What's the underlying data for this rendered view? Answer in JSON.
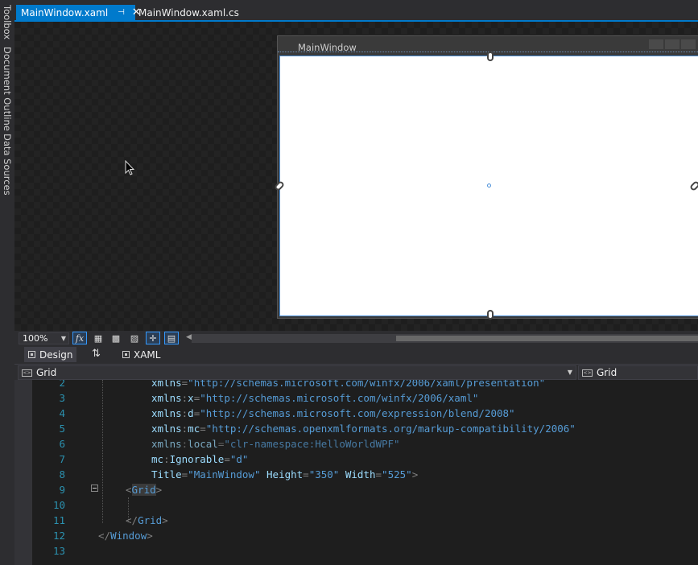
{
  "side_rail": {
    "items": [
      "Toolbox",
      "Document Outline",
      "Data Sources"
    ]
  },
  "tabs": [
    {
      "label": "MainWindow.xaml",
      "active": true
    },
    {
      "label": "MainWindow.xaml.cs",
      "active": false
    }
  ],
  "designer": {
    "window_title": "MainWindow"
  },
  "zoom": {
    "value": "100%",
    "fx_label": "fx"
  },
  "split_tabs": {
    "design": "Design",
    "xaml": "XAML",
    "swap_glyph": "⇅"
  },
  "nav": {
    "left_value": "Grid",
    "right_value": "Grid"
  },
  "editor": {
    "lines": [
      {
        "num": "2",
        "tokens": [
          {
            "t": "xmlns",
            "c": "t-at"
          },
          {
            "t": "=",
            "c": "t-b"
          },
          {
            "t": "\"http://schemas.microsoft.com/winfx/2006/xaml/presentation\"",
            "c": "t-v"
          }
        ]
      },
      {
        "num": "3",
        "tokens": [
          {
            "t": "xmlns",
            "c": "t-at"
          },
          {
            "t": ":",
            "c": "t-b"
          },
          {
            "t": "x",
            "c": "t-at"
          },
          {
            "t": "=",
            "c": "t-b"
          },
          {
            "t": "\"http://schemas.microsoft.com/winfx/2006/xaml\"",
            "c": "t-v"
          }
        ]
      },
      {
        "num": "4",
        "tokens": [
          {
            "t": "xmlns",
            "c": "t-at"
          },
          {
            "t": ":",
            "c": "t-b"
          },
          {
            "t": "d",
            "c": "t-at"
          },
          {
            "t": "=",
            "c": "t-b"
          },
          {
            "t": "\"http://schemas.microsoft.com/expression/blend/2008\"",
            "c": "t-v"
          }
        ]
      },
      {
        "num": "5",
        "tokens": [
          {
            "t": "xmlns",
            "c": "t-at"
          },
          {
            "t": ":",
            "c": "t-b"
          },
          {
            "t": "mc",
            "c": "t-at"
          },
          {
            "t": "=",
            "c": "t-b"
          },
          {
            "t": "\"http://schemas.openxmlformats.org/markup-compatibility/2006\"",
            "c": "t-v"
          }
        ]
      },
      {
        "num": "6",
        "dim": true,
        "tokens": [
          {
            "t": "xmlns",
            "c": "t-at"
          },
          {
            "t": ":",
            "c": "t-b"
          },
          {
            "t": "local",
            "c": "t-at"
          },
          {
            "t": "=",
            "c": "t-b"
          },
          {
            "t": "\"clr-namespace:HelloWorldWPF\"",
            "c": "t-v"
          }
        ]
      },
      {
        "num": "7",
        "tokens": [
          {
            "t": "mc",
            "c": "t-at"
          },
          {
            "t": ":",
            "c": "t-b"
          },
          {
            "t": "Ignorable",
            "c": "t-at"
          },
          {
            "t": "=",
            "c": "t-b"
          },
          {
            "t": "\"d\"",
            "c": "t-v"
          }
        ]
      },
      {
        "num": "8",
        "tokens": [
          {
            "t": "Title",
            "c": "t-at"
          },
          {
            "t": "=",
            "c": "t-b"
          },
          {
            "t": "\"MainWindow\"",
            "c": "t-v"
          },
          {
            "t": " ",
            "c": "t-b"
          },
          {
            "t": "Height",
            "c": "t-at"
          },
          {
            "t": "=",
            "c": "t-b"
          },
          {
            "t": "\"350\"",
            "c": "t-v"
          },
          {
            "t": " ",
            "c": "t-b"
          },
          {
            "t": "Width",
            "c": "t-at"
          },
          {
            "t": "=",
            "c": "t-b"
          },
          {
            "t": "\"525\"",
            "c": "t-v"
          },
          {
            "t": ">",
            "c": "t-b"
          }
        ]
      },
      {
        "num": "9",
        "tokens": [
          {
            "t": "<",
            "c": "t-b"
          },
          {
            "t": "Grid",
            "c": "t-el t-hl"
          },
          {
            "t": ">",
            "c": "t-b"
          }
        ]
      },
      {
        "num": "10",
        "tokens": []
      },
      {
        "num": "11",
        "tokens": [
          {
            "t": "</",
            "c": "t-b"
          },
          {
            "t": "Grid",
            "c": "t-el"
          },
          {
            "t": ">",
            "c": "t-b"
          }
        ]
      },
      {
        "num": "12",
        "tokens": [
          {
            "t": "</",
            "c": "t-b"
          },
          {
            "t": "Window",
            "c": "t-el"
          },
          {
            "t": ">",
            "c": "t-b"
          }
        ]
      },
      {
        "num": "13",
        "tokens": []
      }
    ]
  }
}
